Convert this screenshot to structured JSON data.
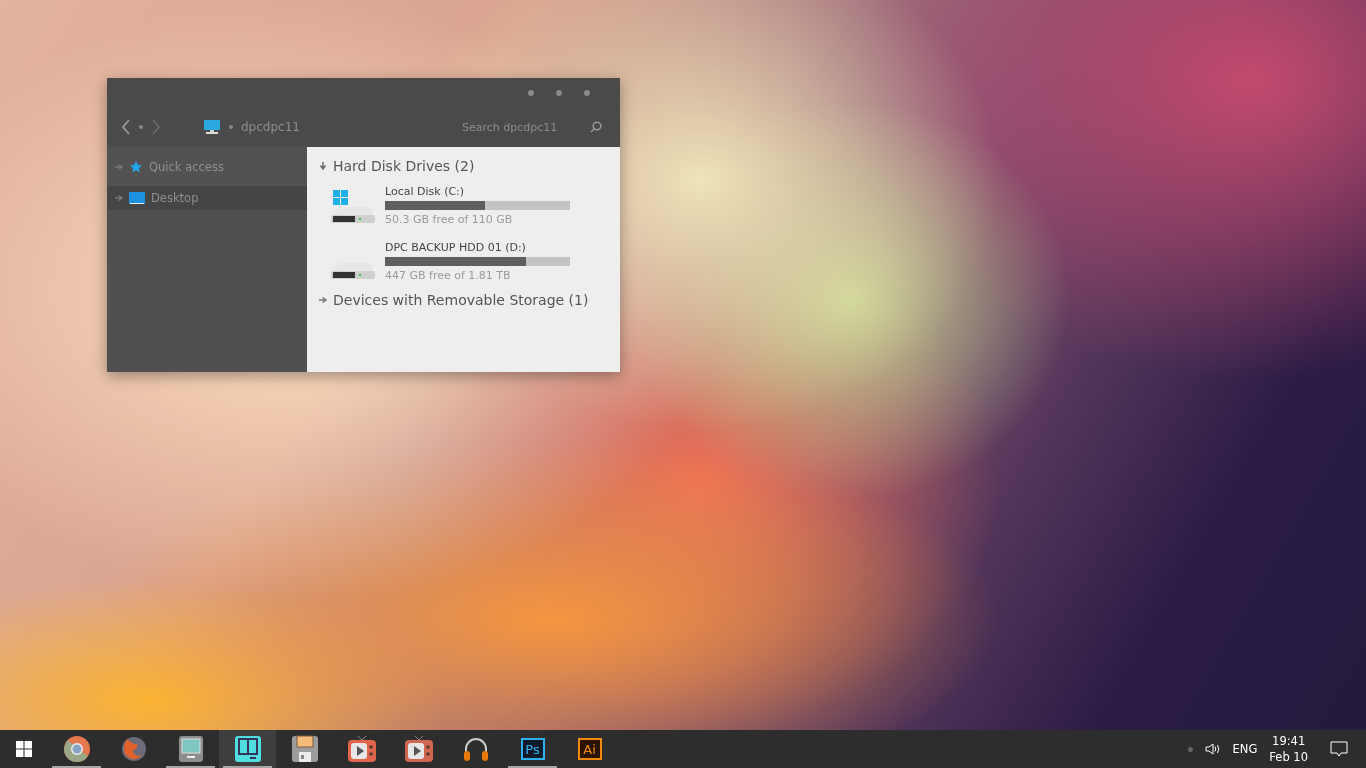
{
  "window": {
    "location": "dpcdpc11",
    "search": {
      "placeholder": "Search dpcdpc11"
    },
    "sidebar": {
      "items": [
        {
          "label": "Quick access",
          "kind": "star",
          "selected": false
        },
        {
          "label": "Desktop",
          "kind": "desktop",
          "selected": true
        }
      ]
    },
    "sections": [
      {
        "title": "Hard Disk Drives (2)",
        "expanded": true,
        "drives": [
          {
            "name": "Local Disk (C:)",
            "kind": "system",
            "level": 0.54,
            "free": "50.3 GB free of 110 GB"
          },
          {
            "name": "DPC BACKUP HDD 01 (D:)",
            "kind": "data",
            "level": 0.76,
            "free": "447 GB free of 1.81 TB"
          }
        ]
      },
      {
        "title": "Devices with Removable Storage (1)",
        "expanded": false
      }
    ]
  },
  "taskbar": {
    "apps": [
      {
        "kind": "chrome",
        "running": true,
        "selected": false
      },
      {
        "kind": "firefox",
        "running": false,
        "selected": false
      },
      {
        "kind": "computer",
        "running": true,
        "selected": false
      },
      {
        "kind": "panels",
        "running": true,
        "selected": true
      },
      {
        "kind": "floppy",
        "running": false,
        "selected": false
      },
      {
        "kind": "tv",
        "running": false,
        "selected": false
      },
      {
        "kind": "tv2",
        "running": false,
        "selected": false
      },
      {
        "kind": "headphones",
        "running": false,
        "selected": false
      },
      {
        "kind": "ps",
        "label": "Ps",
        "running": true,
        "selected": false
      },
      {
        "kind": "ai",
        "label": "Ai",
        "running": false,
        "selected": false
      }
    ],
    "language": "ENG",
    "time": "19:41",
    "date": "Feb 10"
  }
}
